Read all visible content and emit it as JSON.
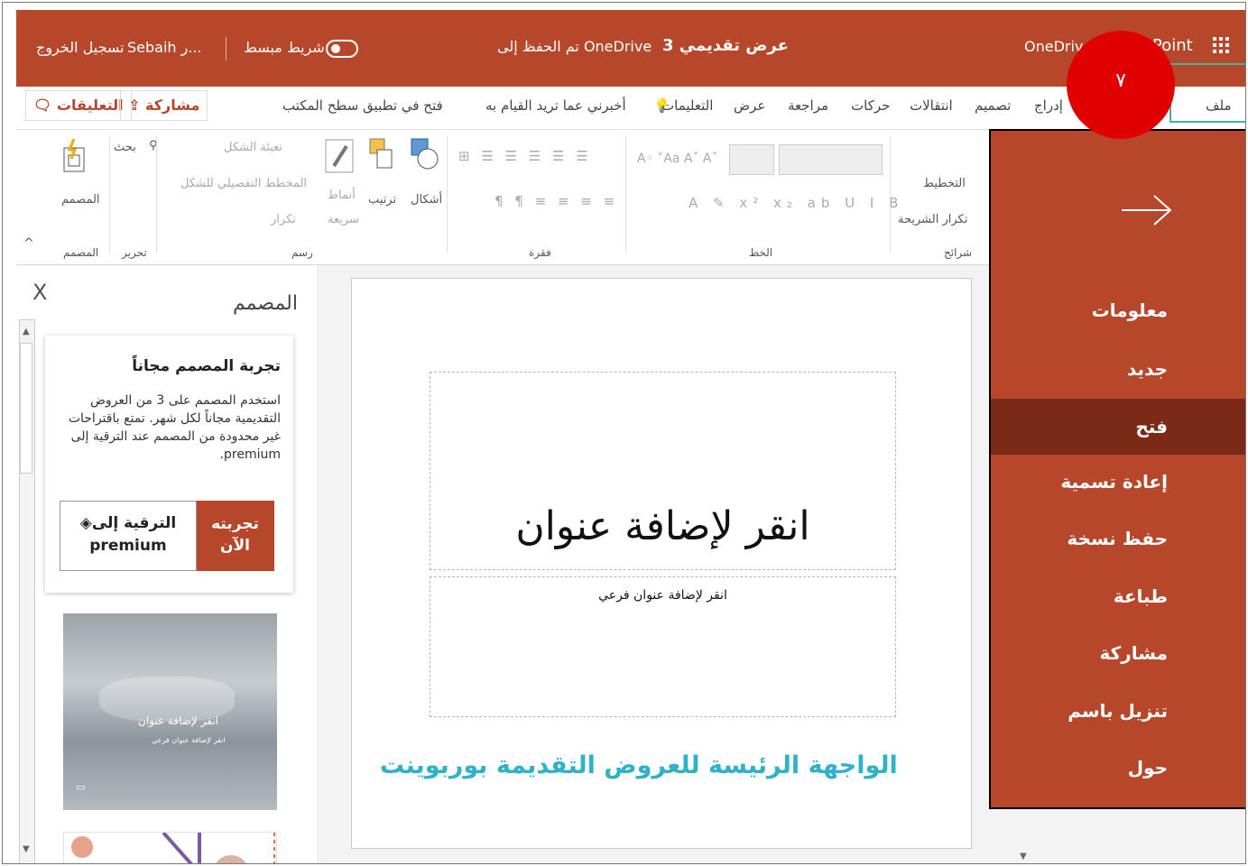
{
  "titlebar": {
    "logout": "تسجيل الخروج",
    "user": "Sebaih ر...",
    "simplified_ribbon": "شريط مبسط",
    "document_title": "عرض تقديمي 3",
    "separator": "-",
    "save_status": "تم الحفظ إلى OneDrive",
    "onedrive": "OneDrive",
    "app_name": "PowerPoint",
    "app_name_visible": "Point"
  },
  "menubar": {
    "comments": "التعليقات",
    "share": "مشاركة",
    "open_desktop": "فتح في تطبيق سطح المكتب",
    "tell_me": "أخبرني عما تريد القيام به",
    "tabs": [
      "التعليمات",
      "عرض",
      "مراجعة",
      "حركات",
      "انتقالات",
      "تصميم",
      "إدراج",
      "ملف"
    ]
  },
  "ribbon": {
    "designer_group": "المصمم",
    "designer_btn": "المصمم",
    "editing_group": "تحرير",
    "search": "بحث",
    "drawing_group": "رسم",
    "shape_fill": "تعبئة الشكل",
    "shape_outline": "المخطط التفصيلي للشكل",
    "duplicate": "تكرار",
    "styles": "أنماط",
    "quick": "سريعة",
    "arrange": "ترتيب",
    "shapes": "أشكال",
    "paragraph_group": "فقرة",
    "font_group": "الخط",
    "slides_group": "شرائح",
    "layout": "التخطيط",
    "duplicate_slide": "تكرار الشريحة",
    "font_size_labels": "Aa",
    "collapse": "^"
  },
  "designer_pane": {
    "title": "المصمم",
    "close": "X",
    "card_title": "تجربة المصمم مجاناً",
    "card_body": "استخدم المصمم على 3 من العروض التقديمية مجاناً لكل شهر. تمتع باقتراحات غير محدودة من المصمم عند الترقية إلى premium.",
    "try_now": "تجربته الآن",
    "upgrade_line1": "الترقية إلى",
    "upgrade_line2": "premium",
    "thumb_title": "انقر لإضافة عنوان",
    "thumb_subtitle": "انقر لإضافة عنوان فرعي"
  },
  "slide": {
    "title_placeholder": "انقر لإضافة عنوان",
    "subtitle_placeholder": "انقر لإضافة عنوان فرعي"
  },
  "caption": "الواجهة الرئيسة للعروض التقديمة بوربوينت",
  "file_menu": {
    "items": [
      "معلومات",
      "جديد",
      "فتح",
      "إعادة تسمية",
      "حفظ نسخة",
      "طباعة",
      "مشاركة",
      "تنزيل باسم",
      "حول"
    ],
    "active": "فتح"
  },
  "badge": "٧",
  "colors": {
    "brand": "#b7472a",
    "active_item": "#7a2a17",
    "badge": "#e00000",
    "caption": "#2fb1c9",
    "highlight_box": "#3fb39b"
  }
}
